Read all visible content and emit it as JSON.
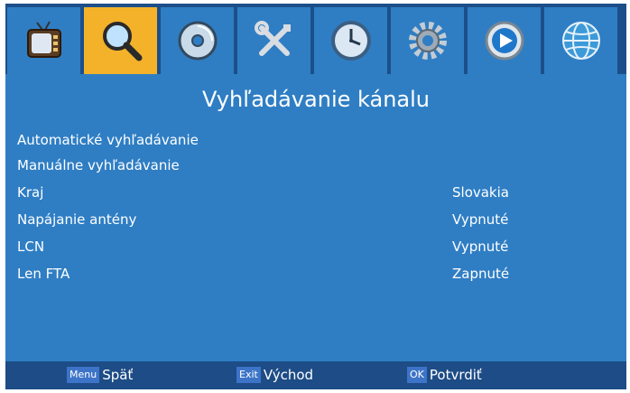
{
  "icon_bar": {
    "tabs": [
      {
        "icon": "tv-icon",
        "active": false
      },
      {
        "icon": "search-icon",
        "active": true
      },
      {
        "icon": "disc-icon",
        "active": false
      },
      {
        "icon": "tools-icon",
        "active": false
      },
      {
        "icon": "clock-icon",
        "active": false
      },
      {
        "icon": "gear-icon",
        "active": false
      },
      {
        "icon": "play-icon",
        "active": false
      },
      {
        "icon": "globe-icon",
        "active": false
      }
    ]
  },
  "page": {
    "title": "Vyhľadávanie kánalu"
  },
  "menu": {
    "items": [
      {
        "label": "Automatické vyhľadávanie",
        "value": ""
      },
      {
        "label": "Manuálne vyhľadávanie",
        "value": ""
      },
      {
        "label": "Kraj",
        "value": "Slovakia"
      },
      {
        "label": "Napájanie antény",
        "value": "Vypnuté"
      },
      {
        "label": "LCN",
        "value": "Vypnuté"
      },
      {
        "label": "Len FTA",
        "value": "Zapnuté"
      }
    ]
  },
  "footer": {
    "menu_key": "Menu",
    "menu_label": "Späť",
    "exit_key": "Exit",
    "exit_label": "Východ",
    "ok_key": "OK",
    "ok_label": "Potvrdiť"
  },
  "colors": {
    "background": "#2f7ec4",
    "icon_bar": "#1c4f8a",
    "active_tab": "#f4b22a",
    "footer": "#1d4c86",
    "key_badge": "#3d74c8"
  }
}
